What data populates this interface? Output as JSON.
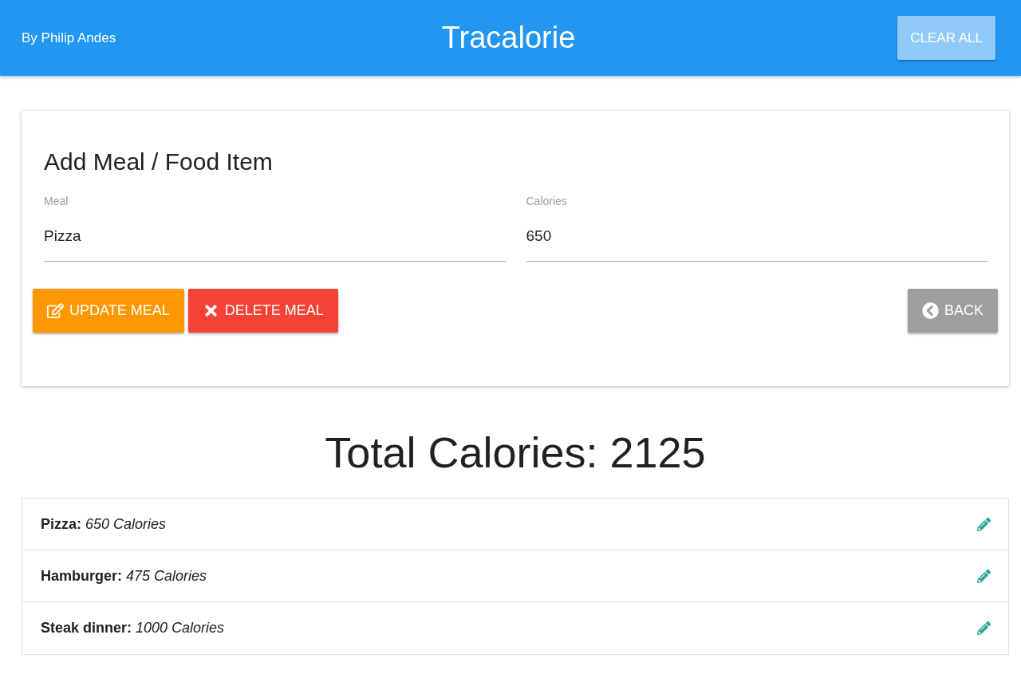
{
  "header": {
    "author": "By Philip Andes",
    "title": "Tracalorie",
    "clear_button": "CLEAR ALL"
  },
  "form": {
    "heading": "Add Meal / Food Item",
    "fields": [
      {
        "label": "Meal",
        "value": "Pizza"
      },
      {
        "label": "Calories",
        "value": "650"
      }
    ],
    "buttons": [
      {
        "kind": "update",
        "label": "UPDATE MEAL"
      },
      {
        "kind": "delete",
        "label": "DELETE MEAL"
      },
      {
        "kind": "back",
        "label": "BACK"
      }
    ]
  },
  "total": "Total Calories: 2125",
  "items": [
    {
      "text": "**Pizza:** *650 Calories*"
    },
    {
      "text": "**Hamburger:** *475 Calories*"
    },
    {
      "text": "**Steak dinner:** *1000 Calories*"
    }
  ]
}
